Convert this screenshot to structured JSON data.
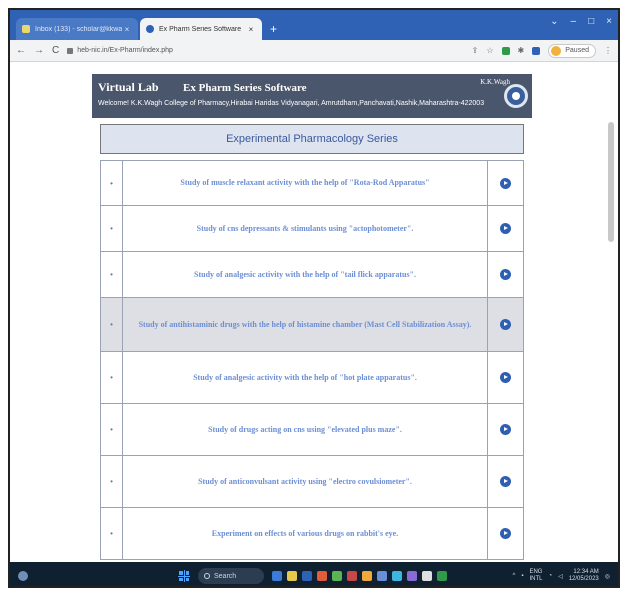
{
  "browser": {
    "tabs": [
      {
        "label": "Inbox (133) - scholar@kkwagh...",
        "close": "×"
      },
      {
        "label": "Ex Pharm Series Software",
        "close": "×"
      }
    ],
    "new_tab": "+",
    "window_controls": [
      "⌄",
      "–",
      "□",
      "×"
    ],
    "url": "heb-nic.in/Ex-Pharm/index.php",
    "paused_label": "Paused"
  },
  "site": {
    "virtual_lab": "Virtual Lab",
    "app_title": "Ex Pharm Series Software",
    "college_short": "K.K.Wagh",
    "welcome_text": "Welcome!   K.K.Wagh College of Pharmacy,Hirabai Haridas Vidyanagari, Amrutdham,Panchavati,Nashik,Maharashtra-422003",
    "series_title": "Experimental Pharmacology Series",
    "bullet": "•",
    "experiments": [
      {
        "text": "Study of muscle relaxant activity with the help of \"Rota-Rod Apparatus\"",
        "highlight": false
      },
      {
        "text": "Study of cns depressants & stimulants using \"actophotometer\".",
        "highlight": false
      },
      {
        "text": "Study of analgesic activity with the help of \"tail flick apparatus\".",
        "highlight": false
      },
      {
        "text": "Study of antihistaminic drugs with the help of histamine chamber (Mast Cell Stabilization Assay).",
        "highlight": true
      },
      {
        "text": "Study of analgesic activity with the help of \"hot plate apparatus\".",
        "highlight": false
      },
      {
        "text": "Study of drugs acting on cns using \"elevated plus maze\".",
        "highlight": false
      },
      {
        "text": "Study of anticonvulsant activity using \"electro covulsiometer\".",
        "highlight": false
      },
      {
        "text": "Experiment on effects of various drugs on rabbit's eye.",
        "highlight": false
      }
    ]
  },
  "taskbar": {
    "search_label": "Search",
    "lang_top": "ENG",
    "lang_bottom": "INTL",
    "time": "12:34 AM",
    "date": "12/05/2023",
    "app_colors": [
      "#3c7bd9",
      "#e8c84a",
      "#2f62b4",
      "#e25b3b",
      "#5ab552",
      "#c84747",
      "#f2a93b",
      "#6a8fd8",
      "#3fb6e2",
      "#8a6bd6",
      "#e0e0e0",
      "#2e9a4a"
    ]
  }
}
